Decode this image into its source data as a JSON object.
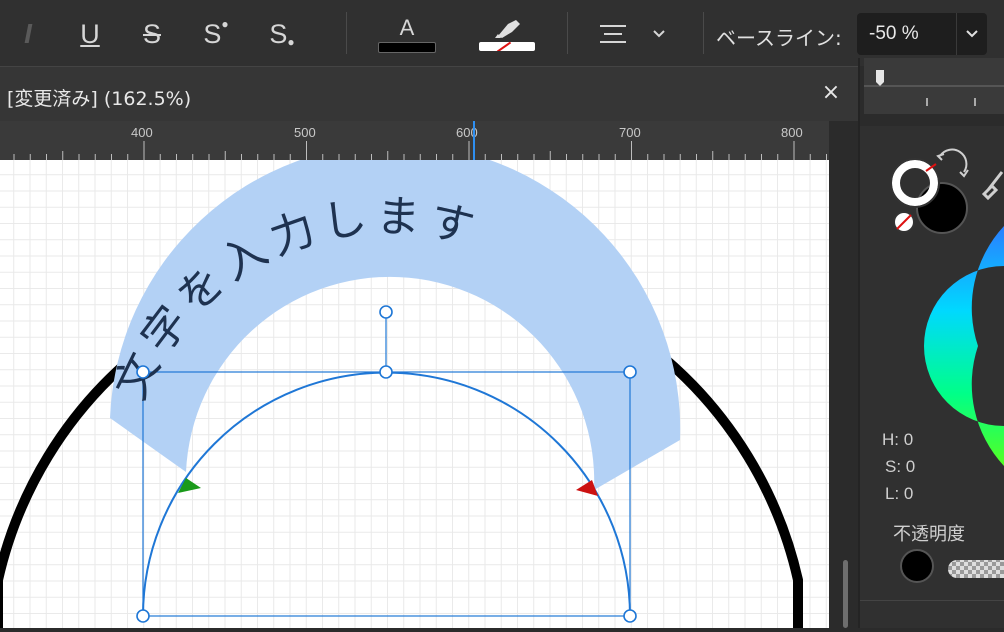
{
  "toolbar": {
    "italic_label": "I",
    "underline_label": "U",
    "strike_label": "S",
    "superscript_label": "S",
    "subscript_label": "S",
    "text_color_label": "A",
    "text_color": "#000000",
    "highlight_color": "#ffffff",
    "baseline_label": "ベースライン:",
    "baseline_value": "-50 %"
  },
  "document": {
    "title": "[変更済み] (162.5%)",
    "close_label": "×"
  },
  "ruler": {
    "labels": [
      "400",
      "500",
      "600",
      "700",
      "800"
    ]
  },
  "canvas": {
    "curved_text": "文字を入力します",
    "selection_color": "#b3d1f5",
    "path_color": "#1f77d6",
    "start_marker_color": "#1a9a1a",
    "end_marker_color": "#cc1111"
  },
  "color_panel": {
    "h_label": "H: 0",
    "s_label": "S: 0",
    "l_label": "L: 0",
    "opacity_label": "不透明度"
  }
}
